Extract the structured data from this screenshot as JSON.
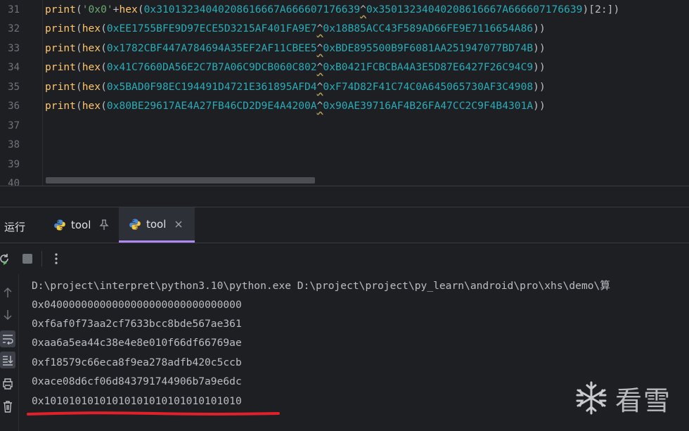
{
  "editor": {
    "line_numbers": [
      "31",
      "32",
      "33",
      "34",
      "35",
      "36",
      "37",
      "38",
      "39",
      "40"
    ],
    "lines": [
      {
        "a": "0x31013234040208616667A666607176639",
        "b": "0x35013234040208616667A666607176639",
        "prefix_str": "'0x0'",
        "suffix": "[2:]"
      },
      {
        "a": "0xEE1755BFE9D97ECE5D3215AF401FA9E7",
        "b": "0x18B85ACC43F589AD66FE9E7116654A86"
      },
      {
        "a": "0x1782CBF447A784694A35EF2AF11CBEE5",
        "b": "0xBDE895500B9F6081AA251947077BD74B"
      },
      {
        "a": "0x41C7660DA56E2C7B7A06C9DCB060C802",
        "b": "0xB0421FCBCBA4A3E5D87E6427F26C94C9"
      },
      {
        "a": "0x5BAD0F98EC194491D4721E361895AFD4",
        "b": "0xF74D82F41C74C0A645065730AF3C4908"
      },
      {
        "a": "0x80BE29617AE4A27FB46CD2D9E4A4200A",
        "b": "0x90AE39716AF4B26FA47CC2C9F4B4301A"
      }
    ],
    "kw_print": "print",
    "kw_hex": "hex"
  },
  "run_panel": {
    "label": "运行",
    "tabs": [
      {
        "label": "tool",
        "action": "pin"
      },
      {
        "label": "tool",
        "action": "close"
      }
    ]
  },
  "console": {
    "lines": [
      "D:\\project\\interpret\\python3.10\\python.exe D:\\project\\project\\py_learn\\android\\pro\\xhs\\demo\\算",
      "0x04000000000000000000000000000000",
      "0xf6af0f73aa2cf7633bcc8bde567ae361",
      "0xaa6a5ea44c38e4e8e010f66df66769ae",
      "0xf18579c66eca8f9ea278adfb420c5ccb",
      "0xace08d6cf06d843791744906b7a9e6dc",
      "0x10101010101010101010101010101010"
    ]
  },
  "watermark": {
    "text": "看雪"
  },
  "colors": {
    "accent_tab": "#b189f5",
    "underline_mark": "#e0202a"
  }
}
